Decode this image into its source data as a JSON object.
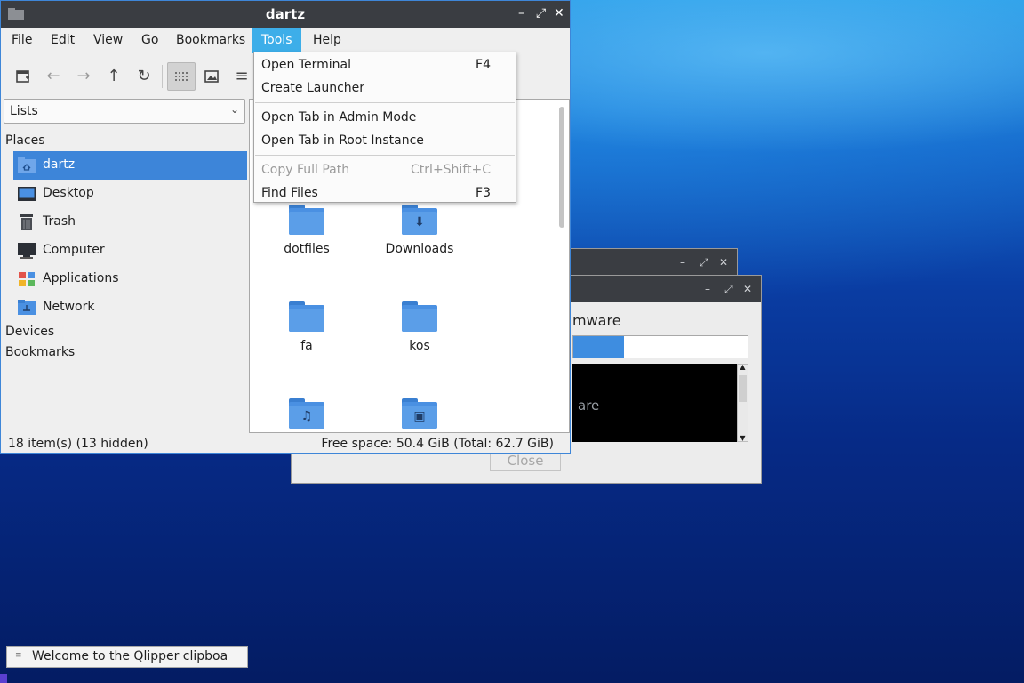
{
  "file_manager": {
    "title": "dartz",
    "menus": [
      "File",
      "Edit",
      "View",
      "Go",
      "Bookmarks",
      "Tools",
      "Help"
    ],
    "active_menu": "Tools",
    "side_pane_mode": "Lists",
    "places_header": "Places",
    "places": [
      {
        "label": "dartz",
        "icon": "home-folder-icon",
        "selected": true
      },
      {
        "label": "Desktop",
        "icon": "desktop-icon"
      },
      {
        "label": "Trash",
        "icon": "trash-icon"
      },
      {
        "label": "Computer",
        "icon": "computer-icon"
      },
      {
        "label": "Applications",
        "icon": "applications-icon"
      },
      {
        "label": "Network",
        "icon": "network-icon"
      }
    ],
    "devices_header": "Devices",
    "bookmarks_header": "Bookmarks",
    "files": [
      {
        "name": "dotfiles",
        "icon": "folder-icon"
      },
      {
        "name": "Downloads",
        "icon": "downloads-folder-icon"
      },
      {
        "name": "fa",
        "icon": "folder-icon"
      },
      {
        "name": "kos",
        "icon": "folder-icon"
      },
      {
        "name": "",
        "icon": "music-folder-icon"
      },
      {
        "name": "",
        "icon": "pictures-folder-icon"
      }
    ],
    "status_left": "18 item(s) (13 hidden)",
    "status_right": "Free space: 50.4 GiB (Total: 62.7 GiB)"
  },
  "tools_menu": {
    "items": [
      {
        "label": "Open Terminal",
        "shortcut": "F4"
      },
      {
        "label": "Create Launcher",
        "shortcut": ""
      },
      {
        "label": "Open Tab in Admin Mode",
        "shortcut": ""
      },
      {
        "label": "Open Tab in Root Instance",
        "shortcut": ""
      },
      {
        "label": "Copy Full Path",
        "shortcut": "Ctrl+Shift+C",
        "disabled": true
      },
      {
        "label": "Find Files",
        "shortcut": "F3"
      }
    ]
  },
  "background_dialog": {
    "heading_fragment": "mware",
    "log_fragment": "are",
    "progress": 0.29,
    "close_label": "Close"
  },
  "notification": {
    "text": "Welcome to the Qlipper clipboa"
  },
  "colors": {
    "accent": "#3d85d9",
    "menu_highlight": "#3daee9",
    "titlebar": "#3a3d42"
  }
}
